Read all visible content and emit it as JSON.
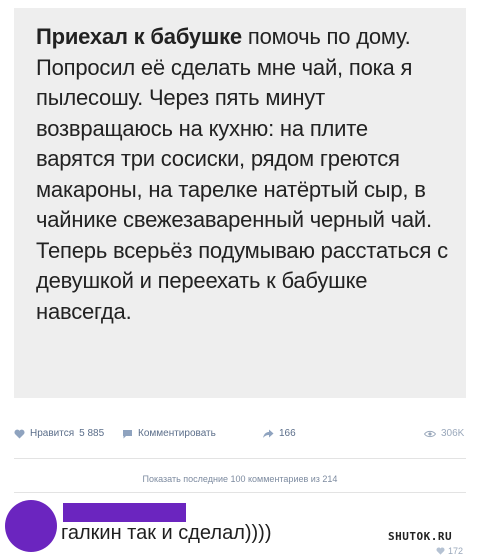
{
  "post": {
    "text_bold": "Приехал к бабушке",
    "text_rest": " помочь по дому. Попросил её сделать мне чай, пока я пылесошу. Через пять минут возвращаюсь на кухню: на плите варятся три сосиски, рядом греются макароны, на тарелке натёртый сыр, в чайнике свежезаваренный черный чай. Теперь всерьёз подумываю расстаться с девушкой и переехать к бабушке навсегда."
  },
  "actions": {
    "like_label": "Нравится",
    "like_count": "5 885",
    "comment_label": "Комментировать",
    "share_count": "166",
    "views": "306K"
  },
  "comments": {
    "show_more": "Показать последние 100 комментариев из 214",
    "items": [
      {
        "text": "галкин так и сделал))))",
        "likes": "172"
      }
    ]
  },
  "watermark": "SHUTOK.RU",
  "colors": {
    "accent": "#6b25bf",
    "meta": "#5b6e8a",
    "card": "#eeeeee"
  }
}
